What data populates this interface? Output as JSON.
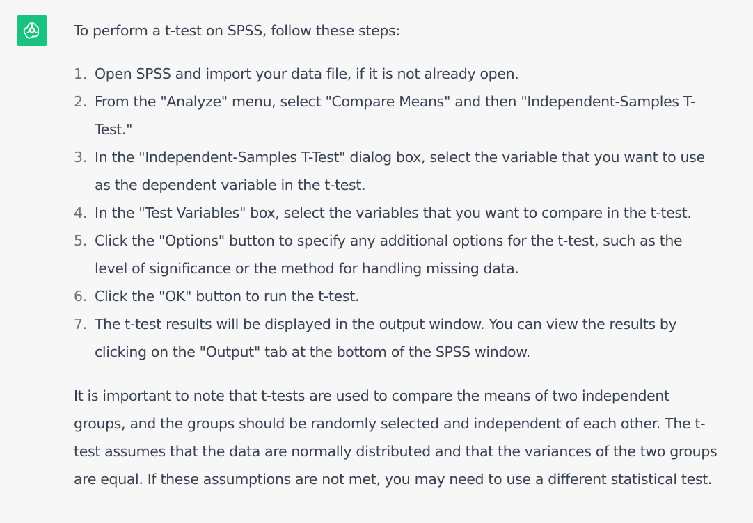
{
  "assistant": {
    "avatar_icon": "openai-logo-icon",
    "avatar_color": "#19c37d"
  },
  "intro": "To perform a t-test on SPSS, follow these steps:",
  "steps": [
    {
      "number": "1.",
      "lines": [
        "Open SPSS and import your data file, if it is not already open."
      ]
    },
    {
      "number": "2.",
      "lines": [
        "From the \"Analyze\" menu, select \"Compare Means\" and then \"Independent-Samples T-",
        "Test.\""
      ]
    },
    {
      "number": "3.",
      "lines": [
        "In the \"Independent-Samples T-Test\" dialog box, select the variable that you want to use",
        "as the dependent variable in the t-test."
      ]
    },
    {
      "number": "4.",
      "lines": [
        "In the \"Test Variables\" box, select the variables that you want to compare in the t-test."
      ]
    },
    {
      "number": "5.",
      "lines": [
        "Click the \"Options\" button to specify any additional options for the t-test, such as the",
        "level of significance or the method for handling missing data."
      ]
    },
    {
      "number": "6.",
      "lines": [
        "Click the \"OK\" button to run the t-test."
      ]
    },
    {
      "number": "7.",
      "lines": [
        "The t-test results will be displayed in the output window. You can view the results by",
        "clicking on the \"Output\" tab at the bottom of the SPSS window."
      ]
    }
  ],
  "closing": {
    "lines": [
      "It is important to note that t-tests are used to compare the means of two independent",
      "groups, and the groups should be randomly selected and independent of each other. The t-",
      "test assumes that the data are normally distributed and that the variances of the two groups",
      "are equal. If these assumptions are not met, you may need to use a different statistical test."
    ]
  }
}
